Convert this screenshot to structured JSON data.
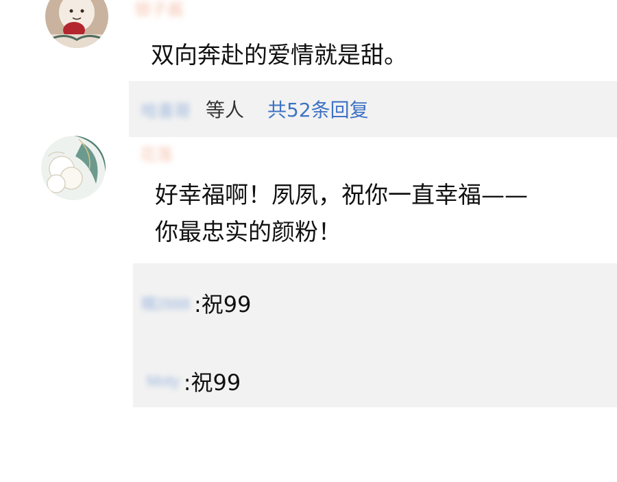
{
  "comments": [
    {
      "username": "银子酱",
      "text": "双向奔赴的爱情就是甜。",
      "reply_summary": {
        "names": "哈喜哥",
        "others_label": "等人",
        "count_label": "共52条回复"
      }
    },
    {
      "username": "花落",
      "text_lines": [
        "好幸福啊！夙夙，祝你一直幸福——",
        "你最忠实的颜粉！"
      ],
      "replies": [
        {
          "username": "糯2888",
          "text": ":祝99"
        },
        {
          "username": "Moty",
          "text": ":祝99"
        }
      ]
    }
  ],
  "colors": {
    "username_orange": "#f6c6b2",
    "reply_link_blue": "#3d72c4",
    "reply_name_blue": "#9bb6dc",
    "reply_bg": "#f2f2f2"
  },
  "icons": {
    "avatar1": "cartoon-character-avatar",
    "avatar2": "floral-avatar"
  }
}
